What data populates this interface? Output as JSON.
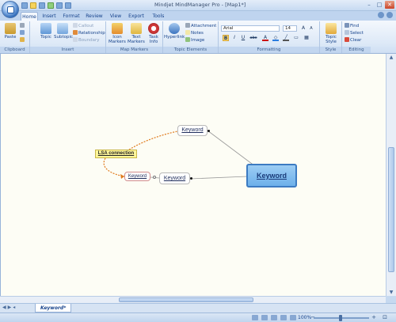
{
  "window": {
    "title": "Mindjet MindManager Pro - [Map1*]",
    "controls": {
      "minimize": "–",
      "maximize": "□",
      "close": "✕"
    }
  },
  "tabs": [
    {
      "label": "Home",
      "active": true
    },
    {
      "label": "Insert"
    },
    {
      "label": "Format"
    },
    {
      "label": "Review"
    },
    {
      "label": "View"
    },
    {
      "label": "Export"
    },
    {
      "label": "Tools"
    }
  ],
  "ribbon": {
    "clipboard": {
      "paste": "Paste",
      "group": "Clipboard"
    },
    "insert": {
      "topic": "Topic",
      "subtopic": "Subtopic",
      "callout": "Callout",
      "relationship": "Relationship",
      "boundary": "Boundary",
      "group": "Insert"
    },
    "map_markers": {
      "icon_markers": "Icon Markers",
      "text_markers": "Text Markers",
      "task_info": "Task Info",
      "group": "Map Markers"
    },
    "topic_elements": {
      "hyperlink": "Hyperlink",
      "attachment": "Attachment",
      "notes": "Notes",
      "image": "Image",
      "group": "Topic Elements"
    },
    "formatting": {
      "font": "Arial",
      "size": "14",
      "bold": "B",
      "italic": "I",
      "underline": "U",
      "strike": "abc",
      "group": "Formatting"
    },
    "style": {
      "topic_style": "Topic Style",
      "group": "Style"
    },
    "editing": {
      "find": "Find",
      "select": "Select",
      "clear": "Clear",
      "group": "Editing"
    }
  },
  "map": {
    "central_topic": "Keyword",
    "top_topic": "Keyword",
    "right_topic": "Keyword",
    "left_topic": "Keyword",
    "callout": "LSA connection"
  },
  "sheet_tab": "Keyword*",
  "status": {
    "zoom": "100%"
  },
  "colors": {
    "central_fill": "#6db0ea",
    "callout_fill": "#fff69a",
    "relationship": "#e07a1c"
  }
}
